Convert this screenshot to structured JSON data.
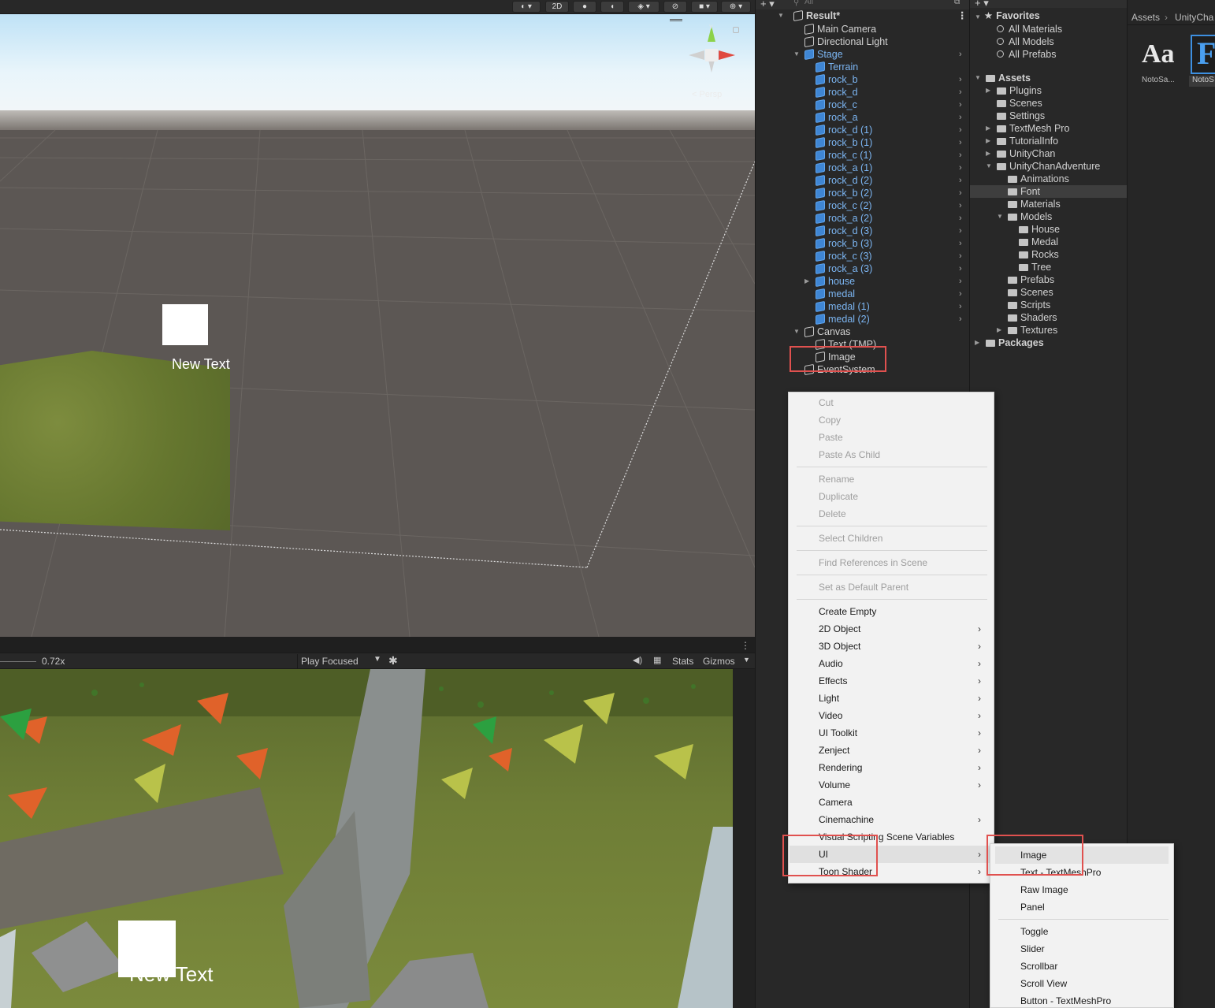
{
  "scene": {
    "toolbar_2d": "2D",
    "persp_label": "< Persp",
    "gizmo_axis_y": "y",
    "overlay_text": "New Text"
  },
  "game": {
    "scale_value": "0.72x",
    "play_mode": "Play Focused",
    "stats_label": "Stats",
    "gizmos_label": "Gizmos",
    "overlay_text": "New Text"
  },
  "hierarchy": {
    "search_placeholder": "All",
    "scene_name": "Result*",
    "items": [
      {
        "label": "Main Camera",
        "indent": 1,
        "type": "object"
      },
      {
        "label": "Directional Light",
        "indent": 1,
        "type": "object"
      },
      {
        "label": "Stage",
        "indent": 1,
        "type": "prefab",
        "expanded": true,
        "arrow": true
      },
      {
        "label": "Terrain",
        "indent": 2,
        "type": "prefab"
      },
      {
        "label": "rock_b",
        "indent": 2,
        "type": "prefab",
        "arrow": true
      },
      {
        "label": "rock_d",
        "indent": 2,
        "type": "prefab",
        "arrow": true
      },
      {
        "label": "rock_c",
        "indent": 2,
        "type": "prefab",
        "arrow": true
      },
      {
        "label": "rock_a",
        "indent": 2,
        "type": "prefab",
        "arrow": true
      },
      {
        "label": "rock_d (1)",
        "indent": 2,
        "type": "prefab",
        "arrow": true
      },
      {
        "label": "rock_b (1)",
        "indent": 2,
        "type": "prefab",
        "arrow": true
      },
      {
        "label": "rock_c (1)",
        "indent": 2,
        "type": "prefab",
        "arrow": true
      },
      {
        "label": "rock_a (1)",
        "indent": 2,
        "type": "prefab",
        "arrow": true
      },
      {
        "label": "rock_d (2)",
        "indent": 2,
        "type": "prefab",
        "arrow": true
      },
      {
        "label": "rock_b (2)",
        "indent": 2,
        "type": "prefab",
        "arrow": true
      },
      {
        "label": "rock_c (2)",
        "indent": 2,
        "type": "prefab",
        "arrow": true
      },
      {
        "label": "rock_a (2)",
        "indent": 2,
        "type": "prefab",
        "arrow": true
      },
      {
        "label": "rock_d (3)",
        "indent": 2,
        "type": "prefab",
        "arrow": true
      },
      {
        "label": "rock_b (3)",
        "indent": 2,
        "type": "prefab",
        "arrow": true
      },
      {
        "label": "rock_c (3)",
        "indent": 2,
        "type": "prefab",
        "arrow": true
      },
      {
        "label": "rock_a (3)",
        "indent": 2,
        "type": "prefab",
        "arrow": true
      },
      {
        "label": "house",
        "indent": 2,
        "type": "prefab",
        "arrow": true,
        "collapsed": true
      },
      {
        "label": "medal",
        "indent": 2,
        "type": "prefab",
        "arrow": true
      },
      {
        "label": "medal (1)",
        "indent": 2,
        "type": "prefab",
        "arrow": true
      },
      {
        "label": "medal (2)",
        "indent": 2,
        "type": "prefab",
        "arrow": true
      },
      {
        "label": "Canvas",
        "indent": 1,
        "type": "object",
        "expanded": true
      },
      {
        "label": "Text (TMP)",
        "indent": 2,
        "type": "object"
      },
      {
        "label": "Image",
        "indent": 2,
        "type": "object"
      },
      {
        "label": "EventSystem",
        "indent": 1,
        "type": "object"
      }
    ]
  },
  "project": {
    "breadcrumb": [
      "Assets",
      "UnityCha"
    ],
    "favorites_label": "Favorites",
    "favorites": [
      "All Materials",
      "All Models",
      "All Prefabs"
    ],
    "tree": [
      {
        "label": "Assets",
        "indent": 0,
        "bold": true,
        "tri": "down"
      },
      {
        "label": "Plugins",
        "indent": 1,
        "tri": "right"
      },
      {
        "label": "Scenes",
        "indent": 1
      },
      {
        "label": "Settings",
        "indent": 1
      },
      {
        "label": "TextMesh Pro",
        "indent": 1,
        "tri": "right"
      },
      {
        "label": "TutorialInfo",
        "indent": 1,
        "tri": "right"
      },
      {
        "label": "UnityChan",
        "indent": 1,
        "tri": "right"
      },
      {
        "label": "UnityChanAdventure",
        "indent": 1,
        "tri": "down"
      },
      {
        "label": "Animations",
        "indent": 2
      },
      {
        "label": "Font",
        "indent": 2,
        "selected": true
      },
      {
        "label": "Materials",
        "indent": 2
      },
      {
        "label": "Models",
        "indent": 2,
        "tri": "down"
      },
      {
        "label": "House",
        "indent": 3
      },
      {
        "label": "Medal",
        "indent": 3
      },
      {
        "label": "Rocks",
        "indent": 3
      },
      {
        "label": "Tree",
        "indent": 3
      },
      {
        "label": "Prefabs",
        "indent": 2
      },
      {
        "label": "Scenes",
        "indent": 2
      },
      {
        "label": "Scripts",
        "indent": 2
      },
      {
        "label": "Shaders",
        "indent": 2
      },
      {
        "label": "Textures",
        "indent": 2,
        "tri": "right"
      },
      {
        "label": "Packages",
        "indent": 0,
        "bold": true,
        "tri": "right"
      }
    ],
    "assets": [
      {
        "preview": "Aa",
        "label": "NotoSa..."
      },
      {
        "preview": "F",
        "label": "NotoS"
      }
    ]
  },
  "context_menu": {
    "groups": [
      [
        {
          "label": "Cut",
          "disabled": true
        },
        {
          "label": "Copy",
          "disabled": true
        },
        {
          "label": "Paste",
          "disabled": true
        },
        {
          "label": "Paste As Child",
          "disabled": true
        }
      ],
      [
        {
          "label": "Rename",
          "disabled": true
        },
        {
          "label": "Duplicate",
          "disabled": true
        },
        {
          "label": "Delete",
          "disabled": true
        }
      ],
      [
        {
          "label": "Select Children",
          "disabled": true
        }
      ],
      [
        {
          "label": "Find References in Scene",
          "disabled": true
        }
      ],
      [
        {
          "label": "Set as Default Parent",
          "disabled": true
        }
      ],
      [
        {
          "label": "Create Empty"
        },
        {
          "label": "2D Object",
          "submenu": true
        },
        {
          "label": "3D Object",
          "submenu": true
        },
        {
          "label": "Audio",
          "submenu": true
        },
        {
          "label": "Effects",
          "submenu": true
        },
        {
          "label": "Light",
          "submenu": true
        },
        {
          "label": "Video",
          "submenu": true
        },
        {
          "label": "UI Toolkit",
          "submenu": true
        },
        {
          "label": "Zenject",
          "submenu": true
        },
        {
          "label": "Rendering",
          "submenu": true
        },
        {
          "label": "Volume",
          "submenu": true
        },
        {
          "label": "Camera"
        },
        {
          "label": "Cinemachine",
          "submenu": true
        },
        {
          "label": "Visual Scripting Scene Variables"
        },
        {
          "label": "UI",
          "submenu": true,
          "highlighted": true
        },
        {
          "label": "Toon Shader",
          "submenu": true
        }
      ]
    ]
  },
  "ui_submenu": {
    "groups": [
      [
        {
          "label": "Image",
          "highlighted": true
        },
        {
          "label": "Text - TextMeshPro"
        },
        {
          "label": "Raw Image"
        },
        {
          "label": "Panel"
        }
      ],
      [
        {
          "label": "Toggle"
        },
        {
          "label": "Slider"
        },
        {
          "label": "Scrollbar"
        },
        {
          "label": "Scroll View"
        },
        {
          "label": "Button - TextMeshPro"
        }
      ]
    ]
  },
  "colors": {
    "accent_blue": "#7cb6f3",
    "annotation_red": "#e0514f",
    "menu_bg": "#f2f2f2",
    "panel_bg": "#282828"
  }
}
